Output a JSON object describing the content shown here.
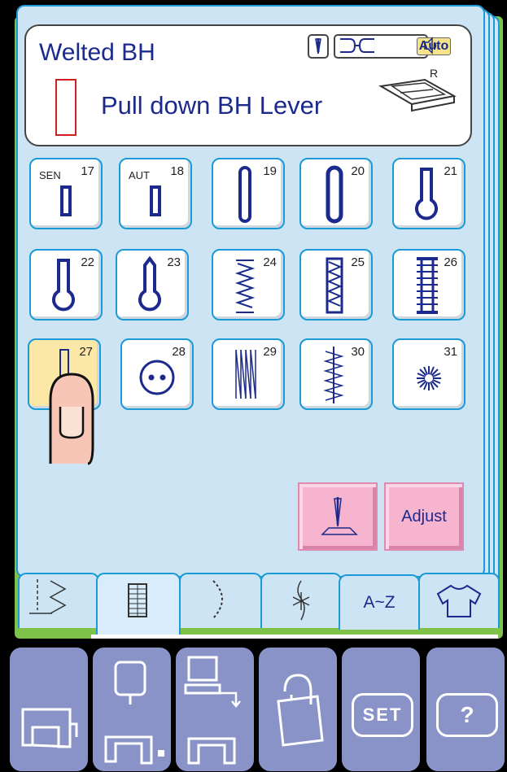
{
  "message": {
    "title": "Welted BH",
    "instruction": "Pull down BH Lever",
    "auto_label": "Auto",
    "foot_label": "R"
  },
  "stitches": [
    {
      "num": "17",
      "prefix": "SEN",
      "selected": false
    },
    {
      "num": "18",
      "prefix": "AUT",
      "selected": false
    },
    {
      "num": "19",
      "prefix": "",
      "selected": false
    },
    {
      "num": "20",
      "prefix": "",
      "selected": false
    },
    {
      "num": "21",
      "prefix": "",
      "selected": false
    },
    {
      "num": "22",
      "prefix": "",
      "selected": false
    },
    {
      "num": "23",
      "prefix": "",
      "selected": false
    },
    {
      "num": "24",
      "prefix": "",
      "selected": false
    },
    {
      "num": "25",
      "prefix": "",
      "selected": false
    },
    {
      "num": "26",
      "prefix": "",
      "selected": false
    },
    {
      "num": "27",
      "prefix": "",
      "selected": true
    },
    {
      "num": "28",
      "prefix": "",
      "selected": false
    },
    {
      "num": "29",
      "prefix": "",
      "selected": false
    },
    {
      "num": "30",
      "prefix": "",
      "selected": false
    },
    {
      "num": "31",
      "prefix": "",
      "selected": false
    }
  ],
  "actions": {
    "adjust_label": "Adjust"
  },
  "tabs": {
    "az_label": "A~Z"
  },
  "bottom_bar": {
    "set_label": "SET",
    "help_label": "?"
  },
  "colors": {
    "accent": "#1a9ad6",
    "text": "#1b2a8c",
    "selected": "#fbe7a6",
    "pink": "#f7b4cf",
    "bottom_button": "#8a93c8"
  }
}
